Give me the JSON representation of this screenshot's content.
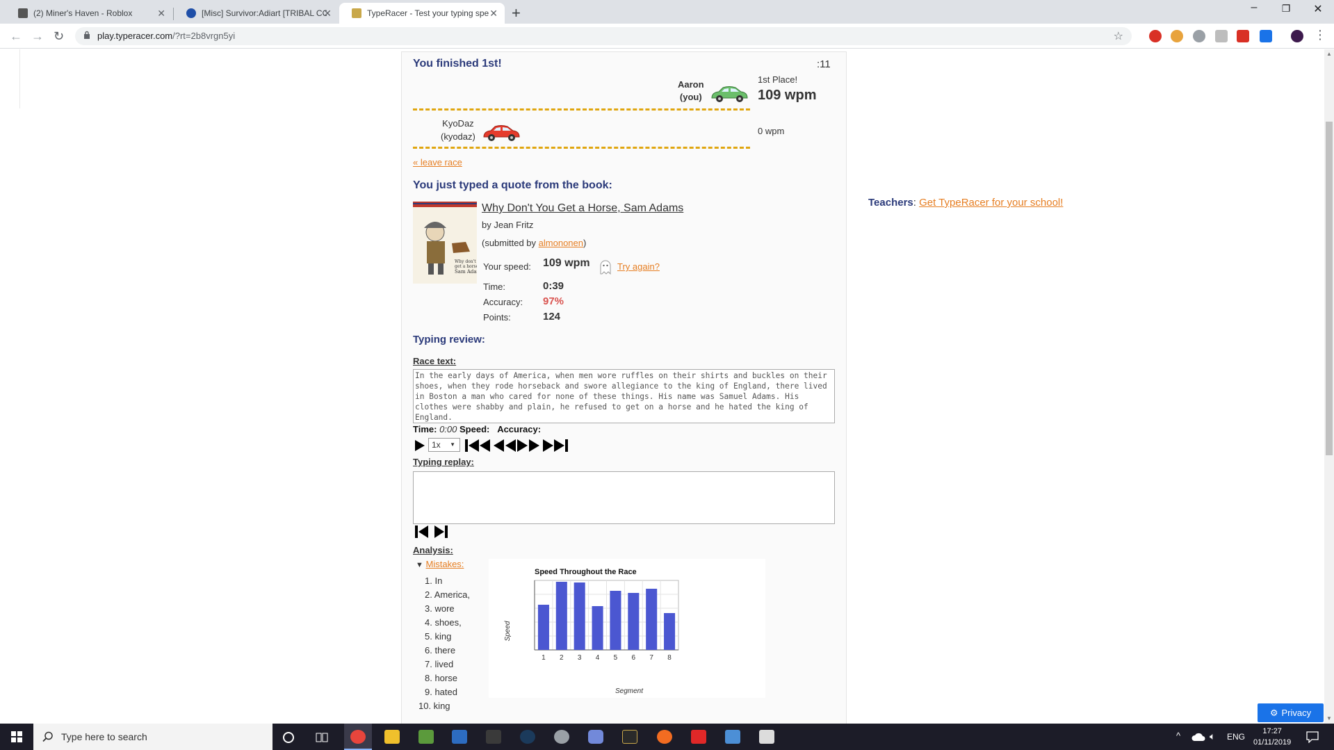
{
  "browser": {
    "tabs": [
      {
        "title": "(2) Miner's Haven - Roblox",
        "active": false
      },
      {
        "title": "[Misc] Survivor:Adiart [TRIBAL CO",
        "active": false
      },
      {
        "title": "TypeRacer - Test your typing spe",
        "active": true
      }
    ],
    "url_host": "play.typeracer.com",
    "url_path": "/?rt=2b8vrgn5yi"
  },
  "race": {
    "result": "You finished 1st!",
    "timer": ":11",
    "player1": {
      "name": "Aaron",
      "tag": "(you)",
      "place": "1st Place!",
      "wpm": "109 wpm",
      "car_color": "#6bbf6b"
    },
    "player2": {
      "name": "KyoDaz",
      "tag": "(kyodaz)",
      "wpm": "0 wpm",
      "car_color": "#e53b2c"
    },
    "leave_race": "« leave race"
  },
  "book": {
    "heading": "You just typed a quote from the book:",
    "title": "Why Don't You Get a Horse, Sam Adams",
    "author": "by Jean Fritz",
    "submitted_prefix": "(submitted by ",
    "submitted_by": "almononen",
    "submitted_suffix": ")"
  },
  "stats": {
    "speed_label": "Your speed:",
    "speed_value": "109 wpm",
    "try_again": "Try again?",
    "time_label": "Time:",
    "time_value": "0:39",
    "accuracy_label": "Accuracy:",
    "accuracy_value": "97%",
    "points_label": "Points:",
    "points_value": "124"
  },
  "review": {
    "heading": "Typing review:",
    "race_text_label": "Race text:",
    "race_text": "In the early days of America, when men wore ruffles on their shirts and buckles on their shoes, when they rode horseback and swore allegiance to the king of England, there lived in Boston a man who cared for none of these things. His name was Samuel Adams. His clothes were shabby and plain, he refused to get on a horse and he hated the king of England.",
    "time_label": "Time:",
    "time_value": "0:00",
    "speed_label": "Speed:",
    "accuracy_label": "Accuracy:",
    "playback_speed": "1x",
    "replay_label": "Typing replay:",
    "analysis_label": "Analysis:",
    "mistakes_label": "Mistakes:",
    "mistakes": [
      "1. In",
      "2. America,",
      "3. wore",
      "4. shoes,",
      "5. king",
      "6. there",
      "7. lived",
      "8. horse",
      "9. hated",
      "10. king"
    ]
  },
  "chart_data": {
    "type": "bar",
    "title": "Speed Throughout the Race",
    "xlabel": "Segment",
    "ylabel": "Speed",
    "categories": [
      "1",
      "2",
      "3",
      "4",
      "5",
      "6",
      "7",
      "8"
    ],
    "values": [
      65,
      98,
      97,
      63,
      85,
      82,
      88,
      53
    ],
    "ylim": [
      0,
      100
    ],
    "grid": true,
    "bar_color": "#4b57d1"
  },
  "sidebar": {
    "teachers_label": "Teachers",
    "teachers_sep": ": ",
    "teachers_link": "Get TypeRacer for your school!"
  },
  "privacy_label": "Privacy",
  "taskbar": {
    "search_placeholder": "Type here to search",
    "lang": "ENG",
    "time": "17:27",
    "date": "01/11/2019"
  }
}
